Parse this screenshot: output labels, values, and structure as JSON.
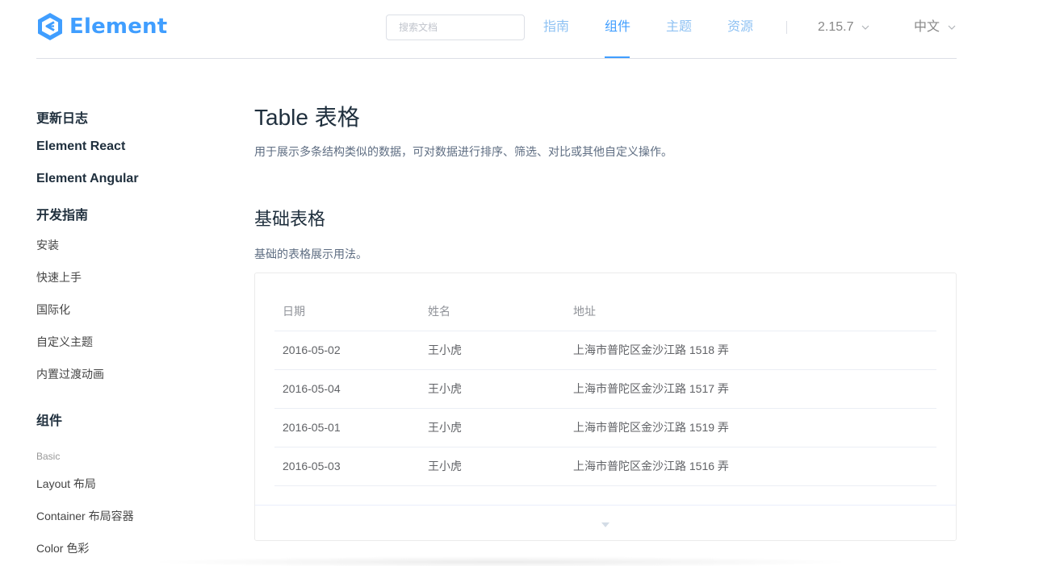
{
  "header": {
    "logo_text": "Element",
    "search_placeholder": "搜索文档",
    "nav": [
      {
        "label": "指南",
        "active": false
      },
      {
        "label": "组件",
        "active": true
      },
      {
        "label": "主题",
        "active": false
      },
      {
        "label": "资源",
        "active": false
      }
    ],
    "version": "2.15.7",
    "language": "中文"
  },
  "sidebar": {
    "items": [
      {
        "label": "更新日志",
        "kind": "heading"
      },
      {
        "label": "Element React",
        "kind": "heading"
      },
      {
        "label": "Element Angular",
        "kind": "heading"
      },
      {
        "label": "开发指南",
        "kind": "heading"
      },
      {
        "label": "安装",
        "kind": "link"
      },
      {
        "label": "快速上手",
        "kind": "link"
      },
      {
        "label": "国际化",
        "kind": "link"
      },
      {
        "label": "自定义主题",
        "kind": "link"
      },
      {
        "label": "内置过渡动画",
        "kind": "link"
      },
      {
        "label": "组件",
        "kind": "heading"
      },
      {
        "label": "Basic",
        "kind": "group"
      },
      {
        "label": "Layout 布局",
        "kind": "link"
      },
      {
        "label": "Container 布局容器",
        "kind": "link"
      },
      {
        "label": "Color 色彩",
        "kind": "link"
      }
    ]
  },
  "main": {
    "title": "Table 表格",
    "description": "用于展示多条结构类似的数据，可对数据进行排序、筛选、对比或其他自定义操作。",
    "section_title": "基础表格",
    "section_description": "基础的表格展示用法。",
    "table": {
      "columns": [
        "日期",
        "姓名",
        "地址"
      ],
      "rows": [
        [
          "2016-05-02",
          "王小虎",
          "上海市普陀区金沙江路 1518 弄"
        ],
        [
          "2016-05-04",
          "王小虎",
          "上海市普陀区金沙江路 1517 弄"
        ],
        [
          "2016-05-01",
          "王小虎",
          "上海市普陀区金沙江路 1519 弄"
        ],
        [
          "2016-05-03",
          "王小虎",
          "上海市普陀区金沙江路 1516 弄"
        ]
      ]
    }
  },
  "colors": {
    "primary": "#409eff",
    "nav_inactive": "#8fc2f3",
    "text_primary": "#1f2f3d",
    "text_secondary": "#5e6d82"
  }
}
